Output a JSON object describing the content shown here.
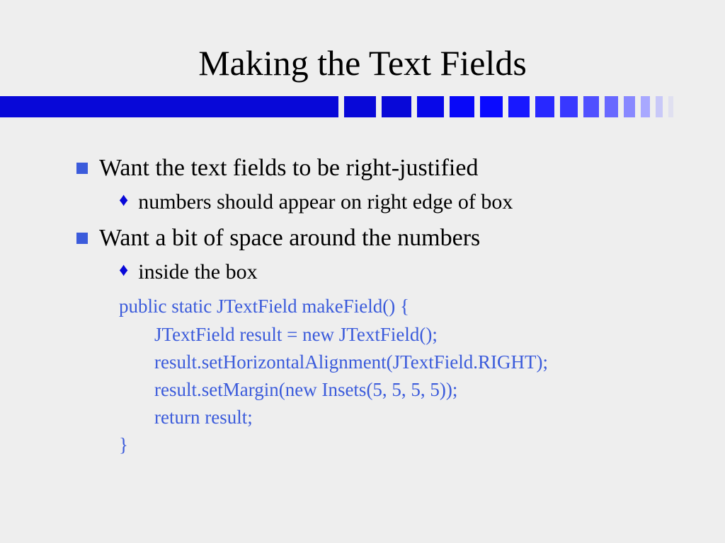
{
  "title": "Making the Text Fields",
  "bullets": [
    {
      "text": "Want the text fields to be right-justified",
      "sub": "numbers should appear on right edge of box"
    },
    {
      "text": "Want a bit of space around the numbers",
      "sub": "inside the box"
    }
  ],
  "code": {
    "line1": "public static JTextField makeField() {",
    "line2": "JTextField result = new JTextField();",
    "line3": "result.setHorizontalAlignment(JTextField.RIGHT);",
    "line4": "result.setMargin(new Insets(5, 5, 5, 5));",
    "line5": "return result;",
    "line6": "}"
  },
  "colors": {
    "squares": [
      "#0808d8",
      "#0000ff",
      "#0000ff",
      "#1a1aff",
      "#1a1aff",
      "#1a1aff",
      "#2020ff",
      "#2a2aff",
      "#3a3aff",
      "#5858ff",
      "#7878ff",
      "#a0a0ff",
      "#c8c8ff",
      "#e8e8f8"
    ]
  }
}
